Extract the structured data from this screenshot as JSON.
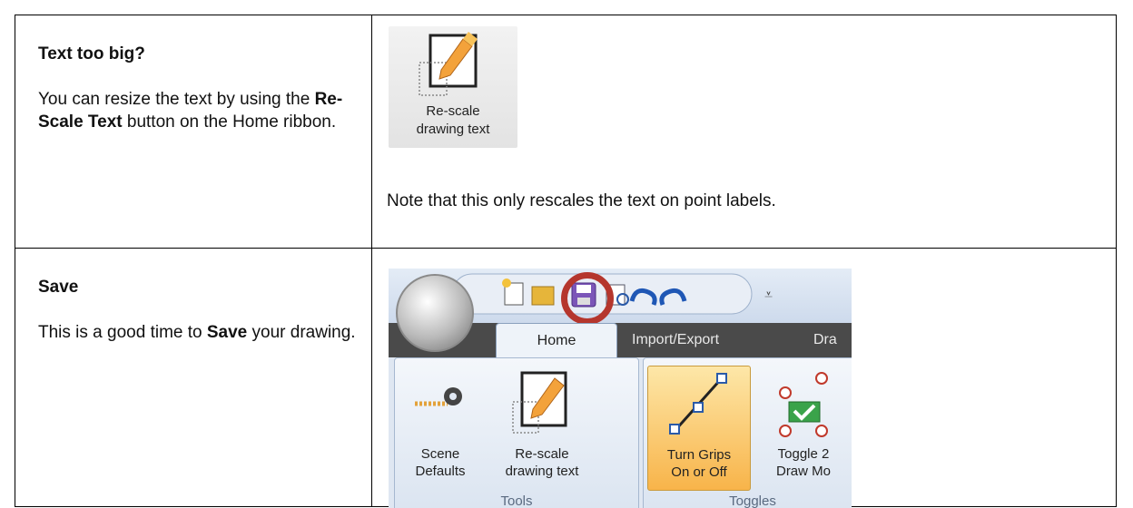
{
  "rows": [
    {
      "heading": "Text too big?",
      "body_before": "You can resize the text by using the ",
      "body_bold": "Re-Scale Text",
      "body_after": " button on the Home ribbon.",
      "button": {
        "label_line1": "Re-scale",
        "label_line2": "drawing text",
        "icon": "rescale-drawing-text-icon"
      },
      "note": "Note that this only rescales the text on point labels."
    },
    {
      "heading": "Save",
      "body_before": "This is a good time to ",
      "body_bold": "Save",
      "body_after": " your drawing.",
      "ribbon": {
        "tabs": [
          "Home",
          "Import/Export",
          "Dra"
        ],
        "buttons": [
          {
            "line1": "Scene",
            "line2": "Defaults",
            "icon": "scene-defaults-icon"
          },
          {
            "line1": "Re-scale",
            "line2": "drawing text",
            "icon": "rescale-drawing-text-icon"
          },
          {
            "line1": "Turn Grips",
            "line2": "On or Off",
            "icon": "grips-icon"
          },
          {
            "line1": "Toggle 2",
            "line2": "Draw Mo",
            "icon": "toggle-draw-mode-icon"
          }
        ],
        "groups": [
          "Tools",
          "Toggles"
        ],
        "highlight_color": "#b5362d"
      }
    }
  ]
}
